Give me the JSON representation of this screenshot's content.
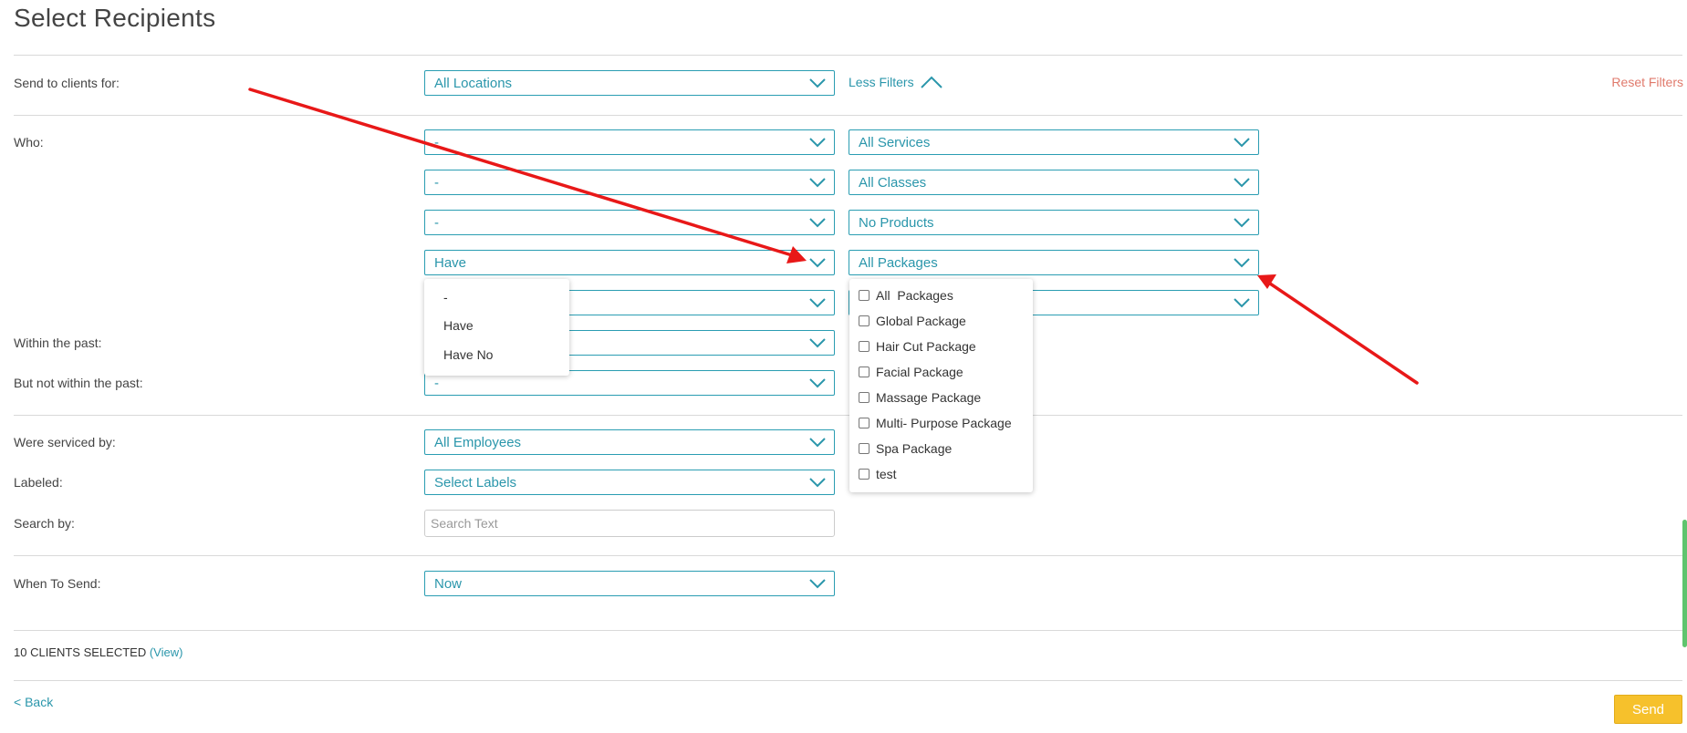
{
  "page": {
    "title": "Select Recipients",
    "less_filters": "Less Filters",
    "reset_filters": "Reset Filters"
  },
  "labels": {
    "send_to": "Send to clients for:",
    "who": "Who:",
    "within_past": "Within the past:",
    "not_within_past": "But not within the past:",
    "serviced_by": "Were serviced by:",
    "labeled": "Labeled:",
    "search_by": "Search by:",
    "when_to_send": "When To Send:"
  },
  "selects": {
    "locations": "All Locations",
    "who_1": "-",
    "who_2": "-",
    "who_3": "-",
    "who_4": "Have",
    "who_5": "",
    "within_past": "",
    "not_within_past": "-",
    "services": "All Services",
    "classes": "All Classes",
    "products": "No Products",
    "packages": "All Packages",
    "right_5": "",
    "employees": "All Employees",
    "labels": "Select Labels",
    "when": "Now"
  },
  "search": {
    "placeholder": "Search Text"
  },
  "have_dropdown": {
    "options": [
      "-",
      "Have",
      "Have No"
    ]
  },
  "packages_dropdown": {
    "items": [
      {
        "label": "All  Packages",
        "checked": false
      },
      {
        "label": "Global Package",
        "checked": false
      },
      {
        "label": "Hair Cut Package",
        "checked": false
      },
      {
        "label": "Facial Package",
        "checked": false
      },
      {
        "label": "Massage Package",
        "checked": false
      },
      {
        "label": "Multi- Purpose Package",
        "checked": false
      },
      {
        "label": "Spa Package",
        "checked": false
      },
      {
        "label": "test",
        "checked": false
      }
    ]
  },
  "footer": {
    "clients_selected": "10 CLIENTS SELECTED",
    "view_link": "(View)",
    "back": "< Back",
    "send": "Send"
  },
  "colors": {
    "accent": "#2a96ab",
    "reset": "#e07a6c",
    "send_button": "#f6c12c",
    "annotation_arrow": "#e81818"
  }
}
